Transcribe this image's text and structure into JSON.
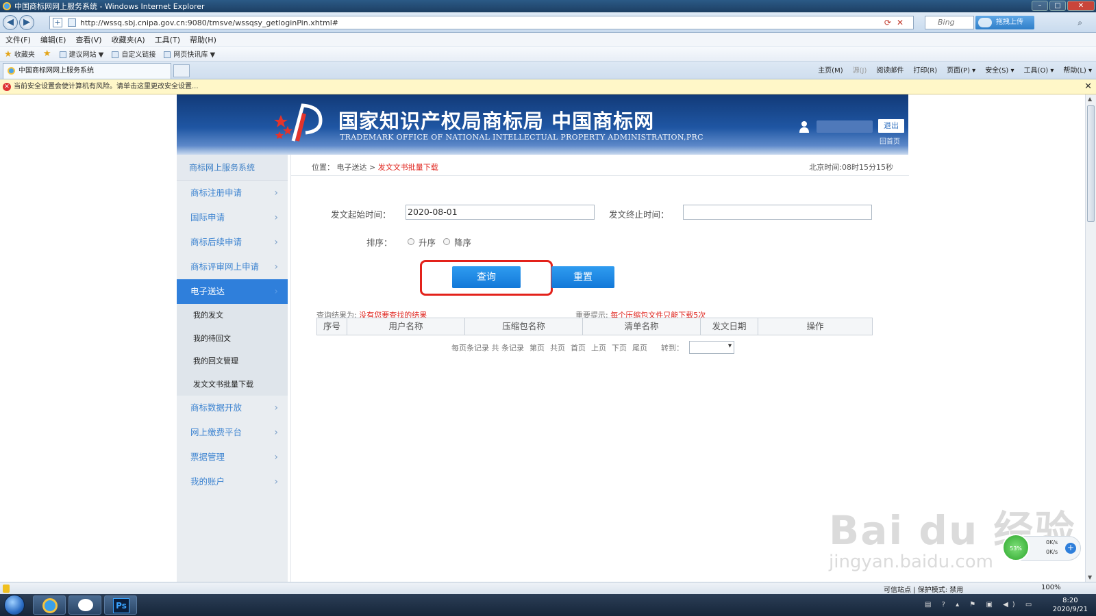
{
  "window": {
    "title": "中国商标网网上服务系统 - Windows Internet Explorer",
    "url": "http://wssq.sbj.cnipa.gov.cn:9080/tmsve/wssqsy_getloginPin.xhtml#",
    "search_placeholder": "Bing",
    "upload_label": "拖拽上传"
  },
  "menu": [
    "文件(F)",
    "编辑(E)",
    "查看(V)",
    "收藏夹(A)",
    "工具(T)",
    "帮助(H)"
  ],
  "favorites": {
    "label": "收藏夹",
    "items": [
      "建议网站 ▼",
      "自定义链接",
      "网页快讯库 ▼"
    ]
  },
  "tab": {
    "title": "中国商标网网上服务系统"
  },
  "commands": [
    "主页(M)",
    "源(J)",
    "阅读邮件",
    "打印(R)",
    "页面(P) ▾",
    "安全(S) ▾",
    "工具(O) ▾",
    "帮助(L) ▾"
  ],
  "infobar": "当前安全设置会使计算机有风险。请单击这里更改安全设置...",
  "header": {
    "title": "国家知识产权局商标局 中国商标网",
    "subtitle": "TRADEMARK OFFICE OF NATIONAL INTELLECTUAL PROPERTY ADMINISTRATION,PRC",
    "logout": "退出",
    "home": "回首页"
  },
  "sidebar": {
    "head": "商标网上服务系统",
    "items": [
      {
        "label": "商标注册申请"
      },
      {
        "label": "国际申请"
      },
      {
        "label": "商标后续申请"
      },
      {
        "label": "商标评审网上申请"
      },
      {
        "label": "电子送达"
      },
      {
        "label": "商标数据开放"
      },
      {
        "label": "网上缴费平台"
      },
      {
        "label": "票据管理"
      },
      {
        "label": "我的账户"
      }
    ],
    "subitems": [
      "我的发文",
      "我的待回文",
      "我的回文管理",
      "发文文书批量下载"
    ]
  },
  "breadcrumb": {
    "prefix": "位置：",
    "parent": "电子送达",
    "sep": ">",
    "current": "发文文书批量下载"
  },
  "clock": "北京时间:08时15分15秒",
  "form": {
    "start_label": "发文起始时间：",
    "start_value": "2020-08-01",
    "end_label": "发文终止时间：",
    "end_value": "",
    "sort_label": "排序：",
    "asc": "升序",
    "desc": "降序",
    "query": "查询",
    "reset": "重置"
  },
  "result": {
    "label": "查询结果为:",
    "value": "没有您要查找的结果",
    "tip_label": "重要提示:",
    "tip_value": "每个压缩包文件只能下载5次"
  },
  "table": {
    "headers": [
      "序号",
      "用户名称",
      "压缩包名称",
      "清单名称",
      "发文日期",
      "操作"
    ]
  },
  "pager": [
    "每页条记录 共 条记录",
    "第页",
    "共页",
    "首页",
    "上页",
    "下页",
    "尾页",
    "转到："
  ],
  "watermark": {
    "main": "Bai du 经验",
    "sub": "jingyan.baidu.com"
  },
  "speed": {
    "up": "0K/s",
    "down": "0K/s",
    "pct": "53%"
  },
  "status": {
    "zone": "可信站点 | 保护模式: 禁用",
    "zoom": "100%"
  },
  "clock_tray": {
    "time": "8:20",
    "date": "2020/9/21"
  }
}
